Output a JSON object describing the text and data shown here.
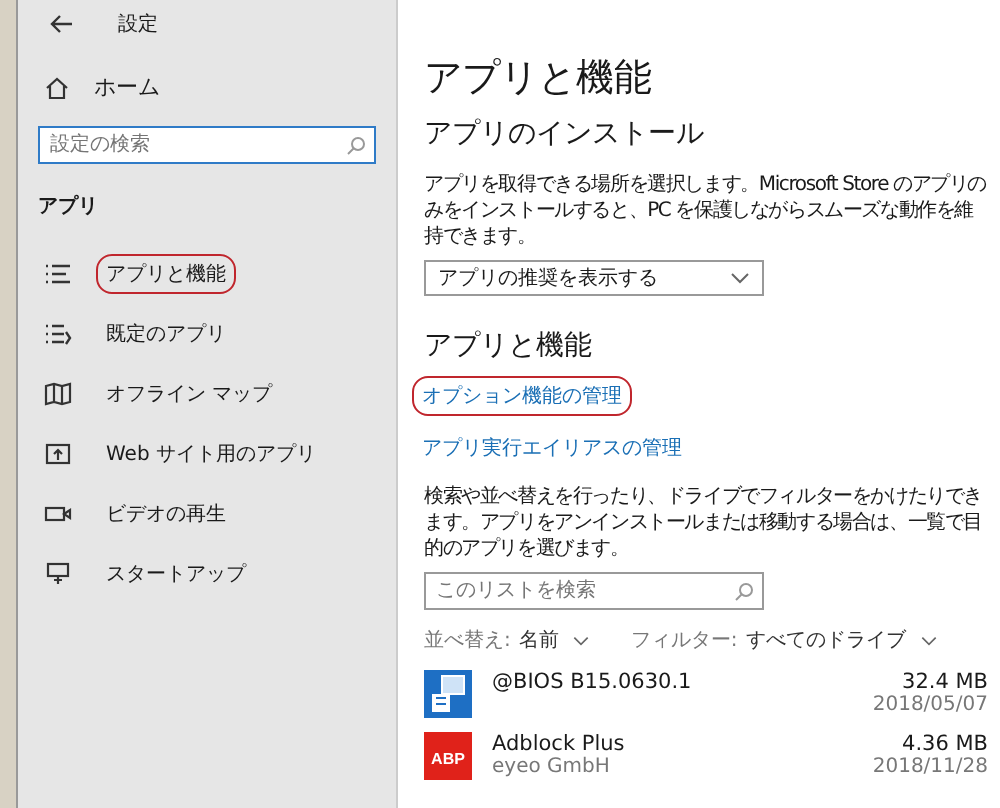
{
  "window": {
    "title": "設定"
  },
  "sidebar": {
    "home": "ホーム",
    "search": {
      "placeholder": "設定の検索"
    },
    "section": "アプリ",
    "items": [
      {
        "label": "アプリと機能",
        "kind": "list",
        "circled": true
      },
      {
        "label": "既定のアプリ",
        "kind": "defaults",
        "circled": false
      },
      {
        "label": "オフライン マップ",
        "kind": "map",
        "circled": false
      },
      {
        "label": "Web サイト用のアプリ",
        "kind": "web",
        "circled": false
      },
      {
        "label": "ビデオの再生",
        "kind": "video",
        "circled": false
      },
      {
        "label": "スタートアップ",
        "kind": "startup",
        "circled": false
      }
    ]
  },
  "main": {
    "title": "アプリと機能",
    "install": {
      "heading": "アプリのインストール",
      "description": "アプリを取得できる場所を選択します。Microsoft Store のアプリのみをインストールすると、PC を保護しながらスムーズな動作を維持できます。",
      "dropdown": "アプリの推奨を表示する"
    },
    "features": {
      "heading": "アプリと機能",
      "links": [
        {
          "label": "オプション機能の管理",
          "circled": true
        },
        {
          "label": "アプリ実行エイリアスの管理",
          "circled": false
        }
      ],
      "description": "検索や並べ替えを行ったり、ドライブでフィルターをかけたりできます。アプリをアンインストールまたは移動する場合は、一覧で目的のアプリを選びます。",
      "search": {
        "placeholder": "このリストを検索"
      },
      "sort": {
        "label": "並べ替え:",
        "value": "名前"
      },
      "filter": {
        "label": "フィルター:",
        "value": "すべてのドライブ"
      },
      "apps": [
        {
          "name": "@BIOS B15.0630.1",
          "size": "32.4 MB",
          "date": "2018/05/07",
          "kind": "installer"
        },
        {
          "name": "Adblock Plus",
          "publisher": "eyeo GmbH",
          "size": "4.36 MB",
          "date": "2018/11/28",
          "kind": "abp",
          "icon_text": "ABP"
        }
      ]
    }
  }
}
